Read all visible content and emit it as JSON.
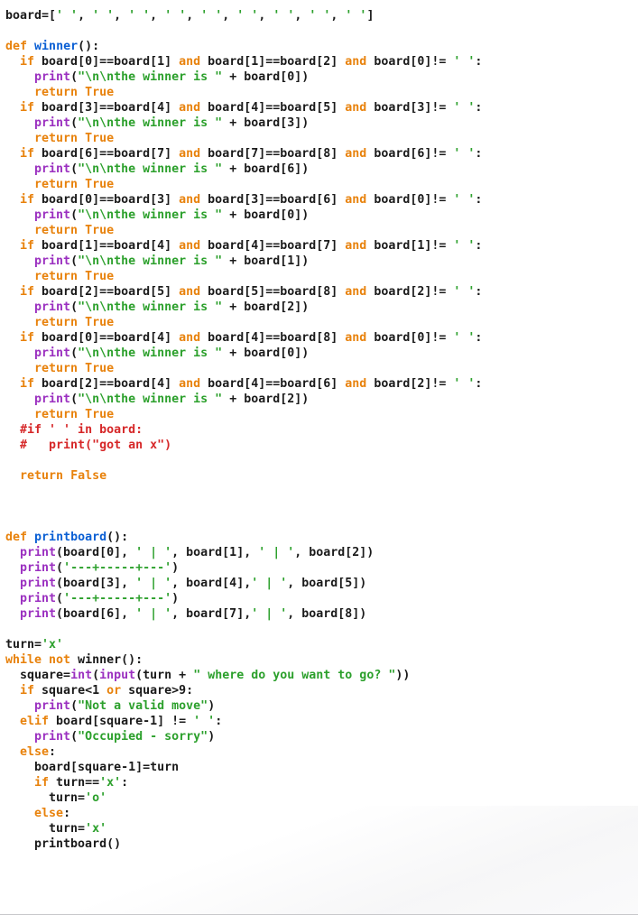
{
  "editor": {
    "language": "Python",
    "background_color": "#ffffff",
    "default_text_color": "#1a1a1a"
  },
  "syntax_colors": {
    "keyword": "#e8820c",
    "function_name": "#0a5fd4",
    "builtin": "#9b30c0",
    "string": "#2ca02c",
    "comment": "#d62728",
    "default": "#1a1a1a"
  },
  "code": {
    "lines": [
      [
        [
          "df",
          "board=["
        ],
        [
          "st",
          "' '"
        ],
        [
          "df",
          ", "
        ],
        [
          "st",
          "' '"
        ],
        [
          "df",
          ", "
        ],
        [
          "st",
          "' '"
        ],
        [
          "df",
          ", "
        ],
        [
          "st",
          "' '"
        ],
        [
          "df",
          ", "
        ],
        [
          "st",
          "' '"
        ],
        [
          "df",
          ", "
        ],
        [
          "st",
          "' '"
        ],
        [
          "df",
          ", "
        ],
        [
          "st",
          "' '"
        ],
        [
          "df",
          ", "
        ],
        [
          "st",
          "' '"
        ],
        [
          "df",
          ", "
        ],
        [
          "st",
          "' '"
        ],
        [
          "df",
          "]"
        ]
      ],
      [],
      [
        [
          "kw",
          "def"
        ],
        [
          "df",
          " "
        ],
        [
          "fn",
          "winner"
        ],
        [
          "df",
          "():"
        ]
      ],
      [
        [
          "df",
          "  "
        ],
        [
          "kw",
          "if"
        ],
        [
          "df",
          " board[0]==board[1] "
        ],
        [
          "kw",
          "and"
        ],
        [
          "df",
          " board[1]==board[2] "
        ],
        [
          "kw",
          "and"
        ],
        [
          "df",
          " board[0]!= "
        ],
        [
          "st",
          "' '"
        ],
        [
          "df",
          ":"
        ]
      ],
      [
        [
          "df",
          "    "
        ],
        [
          "bi",
          "print"
        ],
        [
          "df",
          "("
        ],
        [
          "st",
          "\"\\n\\nthe winner is \""
        ],
        [
          "df",
          " + board[0])"
        ]
      ],
      [
        [
          "df",
          "    "
        ],
        [
          "kw",
          "return"
        ],
        [
          "df",
          " "
        ],
        [
          "kw",
          "True"
        ]
      ],
      [
        [
          "df",
          "  "
        ],
        [
          "kw",
          "if"
        ],
        [
          "df",
          " board[3]==board[4] "
        ],
        [
          "kw",
          "and"
        ],
        [
          "df",
          " board[4]==board[5] "
        ],
        [
          "kw",
          "and"
        ],
        [
          "df",
          " board[3]!= "
        ],
        [
          "st",
          "' '"
        ],
        [
          "df",
          ":"
        ]
      ],
      [
        [
          "df",
          "    "
        ],
        [
          "bi",
          "print"
        ],
        [
          "df",
          "("
        ],
        [
          "st",
          "\"\\n\\nthe winner is \""
        ],
        [
          "df",
          " + board[3])"
        ]
      ],
      [
        [
          "df",
          "    "
        ],
        [
          "kw",
          "return"
        ],
        [
          "df",
          " "
        ],
        [
          "kw",
          "True"
        ]
      ],
      [
        [
          "df",
          "  "
        ],
        [
          "kw",
          "if"
        ],
        [
          "df",
          " board[6]==board[7] "
        ],
        [
          "kw",
          "and"
        ],
        [
          "df",
          " board[7]==board[8] "
        ],
        [
          "kw",
          "and"
        ],
        [
          "df",
          " board[6]!= "
        ],
        [
          "st",
          "' '"
        ],
        [
          "df",
          ":"
        ]
      ],
      [
        [
          "df",
          "    "
        ],
        [
          "bi",
          "print"
        ],
        [
          "df",
          "("
        ],
        [
          "st",
          "\"\\n\\nthe winner is \""
        ],
        [
          "df",
          " + board[6])"
        ]
      ],
      [
        [
          "df",
          "    "
        ],
        [
          "kw",
          "return"
        ],
        [
          "df",
          " "
        ],
        [
          "kw",
          "True"
        ]
      ],
      [
        [
          "df",
          "  "
        ],
        [
          "kw",
          "if"
        ],
        [
          "df",
          " board[0]==board[3] "
        ],
        [
          "kw",
          "and"
        ],
        [
          "df",
          " board[3]==board[6] "
        ],
        [
          "kw",
          "and"
        ],
        [
          "df",
          " board[0]!= "
        ],
        [
          "st",
          "' '"
        ],
        [
          "df",
          ":"
        ]
      ],
      [
        [
          "df",
          "    "
        ],
        [
          "bi",
          "print"
        ],
        [
          "df",
          "("
        ],
        [
          "st",
          "\"\\n\\nthe winner is \""
        ],
        [
          "df",
          " + board[0])"
        ]
      ],
      [
        [
          "df",
          "    "
        ],
        [
          "kw",
          "return"
        ],
        [
          "df",
          " "
        ],
        [
          "kw",
          "True"
        ]
      ],
      [
        [
          "df",
          "  "
        ],
        [
          "kw",
          "if"
        ],
        [
          "df",
          " board[1]==board[4] "
        ],
        [
          "kw",
          "and"
        ],
        [
          "df",
          " board[4]==board[7] "
        ],
        [
          "kw",
          "and"
        ],
        [
          "df",
          " board[1]!= "
        ],
        [
          "st",
          "' '"
        ],
        [
          "df",
          ":"
        ]
      ],
      [
        [
          "df",
          "    "
        ],
        [
          "bi",
          "print"
        ],
        [
          "df",
          "("
        ],
        [
          "st",
          "\"\\n\\nthe winner is \""
        ],
        [
          "df",
          " + board[1])"
        ]
      ],
      [
        [
          "df",
          "    "
        ],
        [
          "kw",
          "return"
        ],
        [
          "df",
          " "
        ],
        [
          "kw",
          "True"
        ]
      ],
      [
        [
          "df",
          "  "
        ],
        [
          "kw",
          "if"
        ],
        [
          "df",
          " board[2]==board[5] "
        ],
        [
          "kw",
          "and"
        ],
        [
          "df",
          " board[5]==board[8] "
        ],
        [
          "kw",
          "and"
        ],
        [
          "df",
          " board[2]!= "
        ],
        [
          "st",
          "' '"
        ],
        [
          "df",
          ":"
        ]
      ],
      [
        [
          "df",
          "    "
        ],
        [
          "bi",
          "print"
        ],
        [
          "df",
          "("
        ],
        [
          "st",
          "\"\\n\\nthe winner is \""
        ],
        [
          "df",
          " + board[2])"
        ]
      ],
      [
        [
          "df",
          "    "
        ],
        [
          "kw",
          "return"
        ],
        [
          "df",
          " "
        ],
        [
          "kw",
          "True"
        ]
      ],
      [
        [
          "df",
          "  "
        ],
        [
          "kw",
          "if"
        ],
        [
          "df",
          " board[0]==board[4] "
        ],
        [
          "kw",
          "and"
        ],
        [
          "df",
          " board[4]==board[8] "
        ],
        [
          "kw",
          "and"
        ],
        [
          "df",
          " board[0]!= "
        ],
        [
          "st",
          "' '"
        ],
        [
          "df",
          ":"
        ]
      ],
      [
        [
          "df",
          "    "
        ],
        [
          "bi",
          "print"
        ],
        [
          "df",
          "("
        ],
        [
          "st",
          "\"\\n\\nthe winner is \""
        ],
        [
          "df",
          " + board[0])"
        ]
      ],
      [
        [
          "df",
          "    "
        ],
        [
          "kw",
          "return"
        ],
        [
          "df",
          " "
        ],
        [
          "kw",
          "True"
        ]
      ],
      [
        [
          "df",
          "  "
        ],
        [
          "kw",
          "if"
        ],
        [
          "df",
          " board[2]==board[4] "
        ],
        [
          "kw",
          "and"
        ],
        [
          "df",
          " board[4]==board[6] "
        ],
        [
          "kw",
          "and"
        ],
        [
          "df",
          " board[2]!= "
        ],
        [
          "st",
          "' '"
        ],
        [
          "df",
          ":"
        ]
      ],
      [
        [
          "df",
          "    "
        ],
        [
          "bi",
          "print"
        ],
        [
          "df",
          "("
        ],
        [
          "st",
          "\"\\n\\nthe winner is \""
        ],
        [
          "df",
          " + board[2])"
        ]
      ],
      [
        [
          "df",
          "    "
        ],
        [
          "kw",
          "return"
        ],
        [
          "df",
          " "
        ],
        [
          "kw",
          "True"
        ]
      ],
      [
        [
          "df",
          "  "
        ],
        [
          "cm",
          "#if ' ' in board:"
        ]
      ],
      [
        [
          "df",
          "  "
        ],
        [
          "cm",
          "#   print(\"got an x\")"
        ]
      ],
      [],
      [
        [
          "df",
          "  "
        ],
        [
          "kw",
          "return"
        ],
        [
          "df",
          " "
        ],
        [
          "kw",
          "False"
        ]
      ],
      [],
      [],
      [],
      [
        [
          "kw",
          "def"
        ],
        [
          "df",
          " "
        ],
        [
          "fn",
          "printboard"
        ],
        [
          "df",
          "():"
        ]
      ],
      [
        [
          "df",
          "  "
        ],
        [
          "bi",
          "print"
        ],
        [
          "df",
          "(board[0], "
        ],
        [
          "st",
          "' | '"
        ],
        [
          "df",
          ", board[1], "
        ],
        [
          "st",
          "' | '"
        ],
        [
          "df",
          ", board[2])"
        ]
      ],
      [
        [
          "df",
          "  "
        ],
        [
          "bi",
          "print"
        ],
        [
          "df",
          "("
        ],
        [
          "st",
          "'---+-----+---'"
        ],
        [
          "df",
          ")"
        ]
      ],
      [
        [
          "df",
          "  "
        ],
        [
          "bi",
          "print"
        ],
        [
          "df",
          "(board[3], "
        ],
        [
          "st",
          "' | '"
        ],
        [
          "df",
          ", board[4],"
        ],
        [
          "st",
          "' | '"
        ],
        [
          "df",
          ", board[5])"
        ]
      ],
      [
        [
          "df",
          "  "
        ],
        [
          "bi",
          "print"
        ],
        [
          "df",
          "("
        ],
        [
          "st",
          "'---+-----+---'"
        ],
        [
          "df",
          ")"
        ]
      ],
      [
        [
          "df",
          "  "
        ],
        [
          "bi",
          "print"
        ],
        [
          "df",
          "(board[6], "
        ],
        [
          "st",
          "' | '"
        ],
        [
          "df",
          ", board[7],"
        ],
        [
          "st",
          "' | '"
        ],
        [
          "df",
          ", board[8])"
        ]
      ],
      [],
      [
        [
          "df",
          "turn="
        ],
        [
          "st",
          "'x'"
        ]
      ],
      [
        [
          "kw",
          "while"
        ],
        [
          "df",
          " "
        ],
        [
          "kw",
          "not"
        ],
        [
          "df",
          " winner():"
        ]
      ],
      [
        [
          "df",
          "  square="
        ],
        [
          "bi",
          "int"
        ],
        [
          "df",
          "("
        ],
        [
          "bi",
          "input"
        ],
        [
          "df",
          "(turn + "
        ],
        [
          "st",
          "\" where do you want to go? \""
        ],
        [
          "df",
          "))"
        ]
      ],
      [
        [
          "df",
          "  "
        ],
        [
          "kw",
          "if"
        ],
        [
          "df",
          " square<1 "
        ],
        [
          "kw",
          "or"
        ],
        [
          "df",
          " square>9:"
        ]
      ],
      [
        [
          "df",
          "    "
        ],
        [
          "bi",
          "print"
        ],
        [
          "df",
          "("
        ],
        [
          "st",
          "\"Not a valid move\""
        ],
        [
          "df",
          ")"
        ]
      ],
      [
        [
          "df",
          "  "
        ],
        [
          "kw",
          "elif"
        ],
        [
          "df",
          " board[square-1] != "
        ],
        [
          "st",
          "' '"
        ],
        [
          "df",
          ":"
        ]
      ],
      [
        [
          "df",
          "    "
        ],
        [
          "bi",
          "print"
        ],
        [
          "df",
          "("
        ],
        [
          "st",
          "\"Occupied - sorry\""
        ],
        [
          "df",
          ")"
        ]
      ],
      [
        [
          "df",
          "  "
        ],
        [
          "kw",
          "else"
        ],
        [
          "df",
          ":"
        ]
      ],
      [
        [
          "df",
          "    board[square-1]=turn"
        ]
      ],
      [
        [
          "df",
          "    "
        ],
        [
          "kw",
          "if"
        ],
        [
          "df",
          " turn=="
        ],
        [
          "st",
          "'x'"
        ],
        [
          "df",
          ":"
        ]
      ],
      [
        [
          "df",
          "      turn="
        ],
        [
          "st",
          "'o'"
        ]
      ],
      [
        [
          "df",
          "    "
        ],
        [
          "kw",
          "else"
        ],
        [
          "df",
          ":"
        ]
      ],
      [
        [
          "df",
          "      turn="
        ],
        [
          "st",
          "'x'"
        ]
      ],
      [
        [
          "df",
          "    printboard()"
        ]
      ]
    ]
  }
}
